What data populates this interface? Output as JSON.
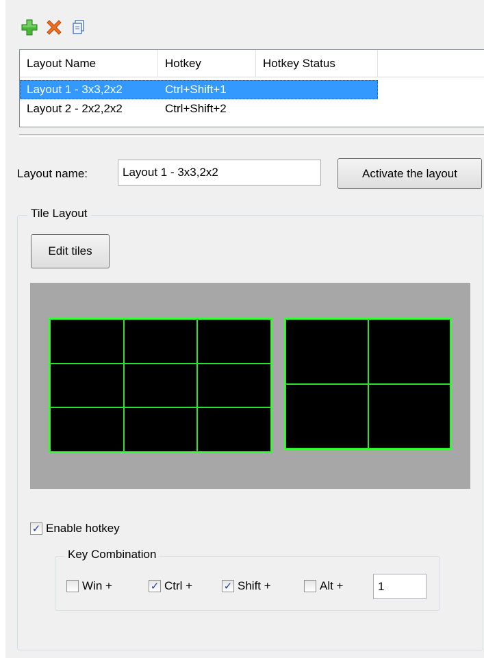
{
  "toolbar": {
    "add_icon": "plus-icon",
    "delete_icon": "x-icon",
    "copy_icon": "copy-icon"
  },
  "list": {
    "columns": [
      "Layout Name",
      "Hotkey",
      "Hotkey Status"
    ],
    "rows": [
      {
        "name": "Layout 1 - 3x3,2x2",
        "hotkey": "Ctrl+Shift+1",
        "status": "",
        "selected": true
      },
      {
        "name": "Layout 2 - 2x2,2x2",
        "hotkey": "Ctrl+Shift+2",
        "status": "",
        "selected": false
      }
    ]
  },
  "layout_name": {
    "label": "Layout name:",
    "value": "Layout 1 - 3x3,2x2"
  },
  "activate_button": "Activate the layout",
  "tile_layout": {
    "title": "Tile Layout",
    "edit_button": "Edit tiles",
    "grids": [
      {
        "rows": 3,
        "cols": 3
      },
      {
        "rows": 2,
        "cols": 2
      }
    ]
  },
  "hotkey": {
    "enable_label": "Enable hotkey",
    "enabled": true,
    "group_title": "Key Combination",
    "win": {
      "label": "Win +",
      "checked": false
    },
    "ctrl": {
      "label": "Ctrl +",
      "checked": true
    },
    "shift": {
      "label": "Shift +",
      "checked": true
    },
    "alt": {
      "label": "Alt +",
      "checked": false
    },
    "key": "1"
  },
  "colors": {
    "selection": "#3399ff",
    "tile_border": "#33ff33",
    "preview_bg": "#a7a7a7"
  }
}
